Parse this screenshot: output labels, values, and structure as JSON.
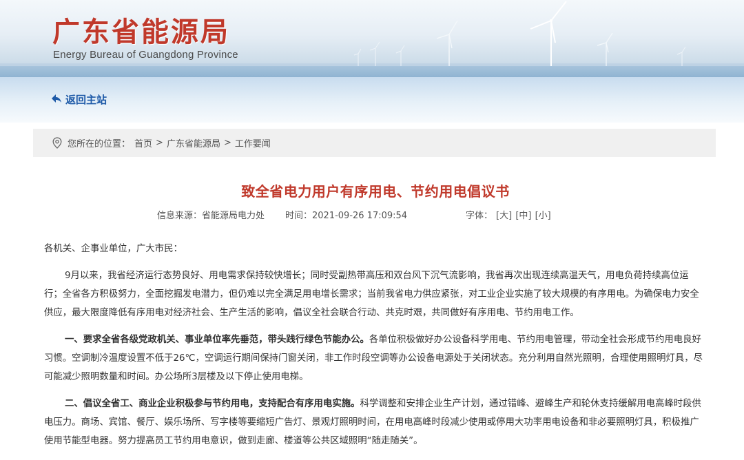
{
  "header": {
    "site_title": "广东省能源局",
    "site_subtitle": "Energy Bureau of Guangdong Province"
  },
  "nav": {
    "back_label": "返回主站"
  },
  "breadcrumb": {
    "prefix": "您所在的位置：",
    "items": [
      "首页",
      "广东省能源局",
      "工作要闻"
    ],
    "separator": ">"
  },
  "article": {
    "title": "致全省电力用户有序用电、节约用电倡议书",
    "source": "信息来源：省能源局电力处",
    "time": "时间：2021-09-26 17:09:54",
    "font_size_label": "字体：",
    "font_size_options": [
      "[大]",
      "[中]",
      "[小]"
    ],
    "salutation": "各机关、企事业单位，广大市民：",
    "paragraph1": "9月以来，我省经济运行态势良好、用电需求保持较快增长；同时受副热带高压和双台风下沉气流影响，我省再次出现连续高温天气，用电负荷持续高位运行；全省各方积极努力，全面挖掘发电潜力，但仍难以完全满足用电增长需求；当前我省电力供应紧张，对工业企业实施了较大规模的有序用电。为确保电力安全供应，最大限度降低有序用电对经济社会、生产生活的影响，倡议全社会联合行动、共克时艰，共同做好有序用电、节约用电工作。",
    "point1_heading": "一、要求全省各级党政机关、事业单位率先垂范，带头践行绿色节能办公。",
    "point1_body": "各单位积极做好办公设备科学用电、节约用电管理，带动全社会形成节约用电良好习惯。空调制冷温度设置不低于26℃，空调运行期间保持门窗关闭，非工作时段空调等办公设备电源处于关闭状态。充分利用自然光照明，合理使用照明灯具，尽可能减少照明数量和时间。办公场所3层楼及以下停止使用电梯。",
    "point2_heading": "二、倡议全省工、商业企业积极参与节约用电，支持配合有序用电实施。",
    "point2_body": "科学调整和安排企业生产计划，通过错峰、避峰生产和轮休支持缓解用电高峰时段供电压力。商场、宾馆、餐厅、娱乐场所、写字楼等要缩短广告灯、景观灯照明时间，在用电高峰时段减少使用或停用大功率用电设备和非必要照明灯具，积极推广使用节能型电器。努力提高员工节约用电意识，做到走廊、楼道等公共区域照明“随走随关”。"
  },
  "colors": {
    "title_red": "#c0392b",
    "link_blue": "#1e5aa8",
    "breadcrumb_bg": "#f0f0f0"
  }
}
